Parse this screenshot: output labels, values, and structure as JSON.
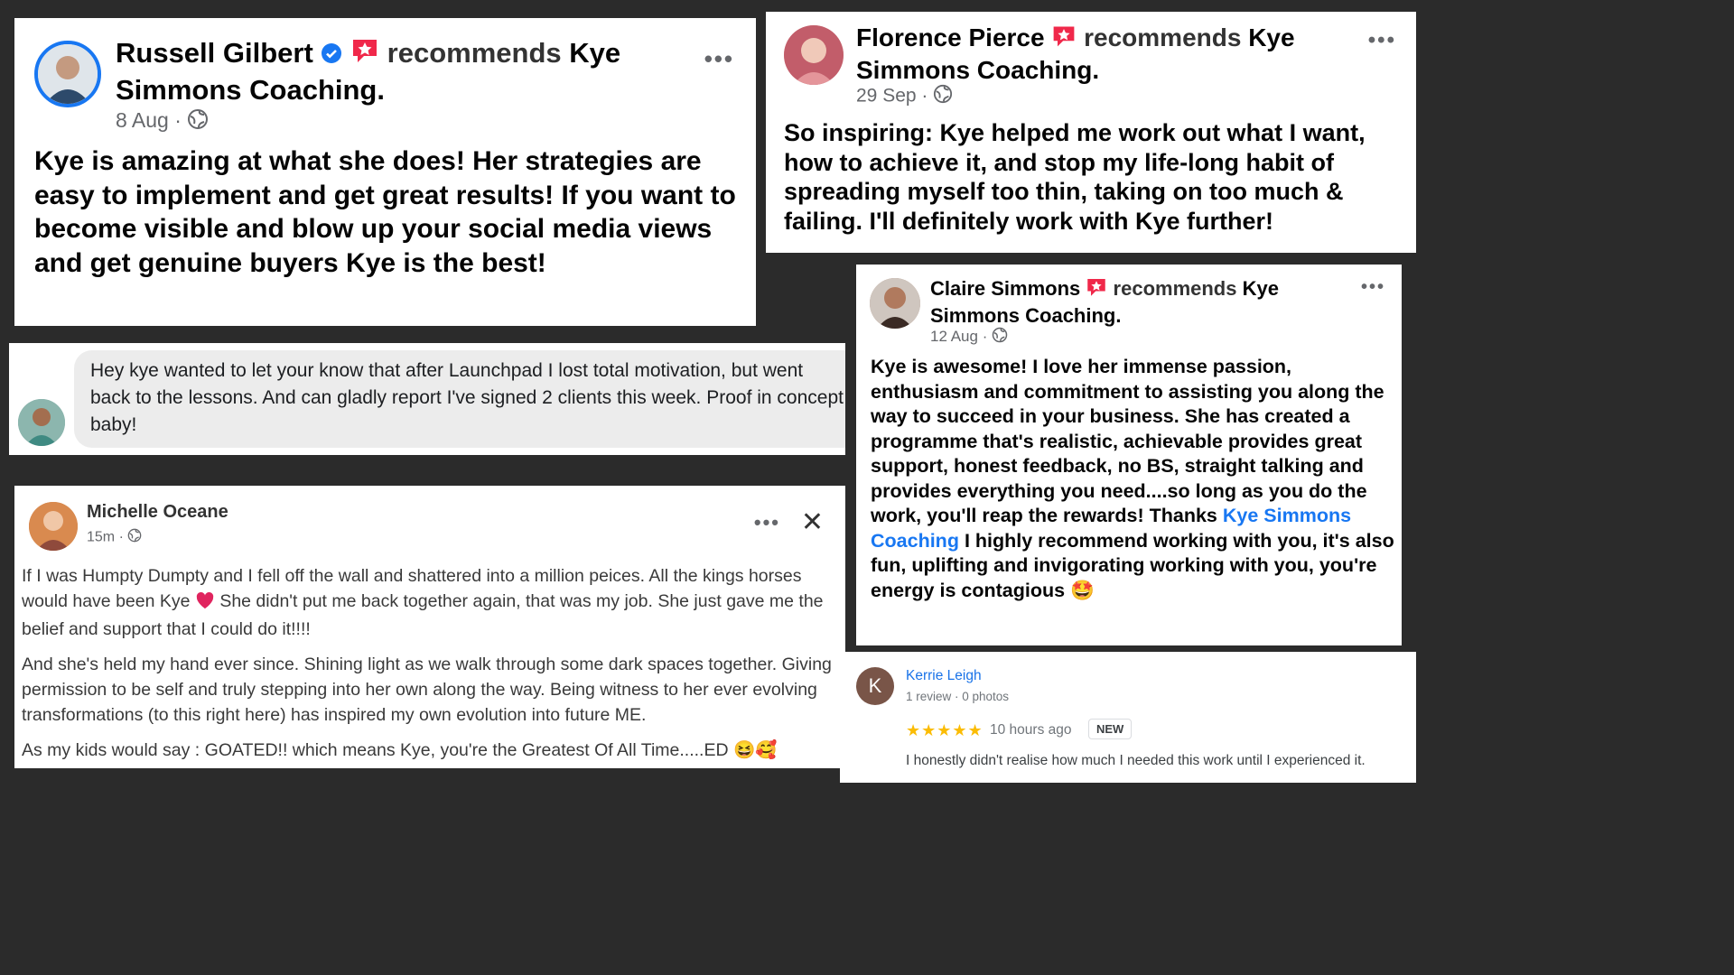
{
  "cards": [
    {
      "name": "Russell Gilbert",
      "recommends": "recommends",
      "page": "Kye Simmons Coaching.",
      "date": "8 Aug",
      "body": "Kye is amazing at what she does! Her strategies are easy to implement and get great results! If you want to become visible and blow up your social media views and get genuine buyers Kye is the best!"
    },
    {
      "name": "Florence Pierce",
      "recommends": "recommends",
      "page": "Kye Simmons Coaching.",
      "date": "29 Sep",
      "body": "So inspiring: Kye helped me work out what I want, how to achieve it, and stop my life-long habit of spreading myself too thin, taking on too much & failing. I'll definitely work with Kye further!"
    }
  ],
  "message": {
    "text": "Hey kye wanted to let your know that after Launchpad I lost total motivation, but went back to the lessons. And can gladly report I've signed 2 clients this week. Proof in concept baby!"
  },
  "michelle": {
    "name": "Michelle Oceane",
    "time": "15m",
    "p1a": "If I was Humpty Dumpty and I fell off the wall and shattered into a million peices. All the kings horses would have been Kye",
    "p1b": "She didn't put me back together again, that was my job. She just gave me the belief and support that I could do it!!!!",
    "p2": "And she's held my hand ever since. Shining light as we walk through some dark spaces together. Giving permission to be self and truly stepping into her own along the way. Being witness to her ever evolving transformations (to this right here) has inspired my own evolution into future ME.",
    "p3": "As my kids would say : GOATED!! which means Kye, you're the Greatest Of All Time.....ED",
    "p3_emoji": "😆🥰"
  },
  "claire": {
    "name": "Claire Simmons",
    "recommends": "recommends",
    "page": "Kye Simmons Coaching.",
    "date": "12 Aug",
    "body_a": "Kye is awesome! I love her immense passion, enthusiasm and commitment to assisting you along the way to succeed in your business. She has created a programme that's realistic, achievable provides great support, honest feedback, no BS, straight talking and provides everything you need....so long as you do the work, you'll reap the rewards! Thanks",
    "body_link": "Kye Simmons Coaching",
    "body_b": "I highly recommend working with you, it's also fun, uplifting and invigorating working with you, you're energy is contagious",
    "emoji": "🤩"
  },
  "review": {
    "initial": "K",
    "name": "Kerrie Leigh",
    "sub": "1 review · 0 photos",
    "stars": "★★★★★",
    "rating": 5,
    "time": "10 hours ago",
    "badge": "NEW",
    "text": "I honestly didn't realise how much I needed this work until I experienced it."
  },
  "more_glyph": "•••",
  "close_glyph": "✕",
  "dot": "·"
}
